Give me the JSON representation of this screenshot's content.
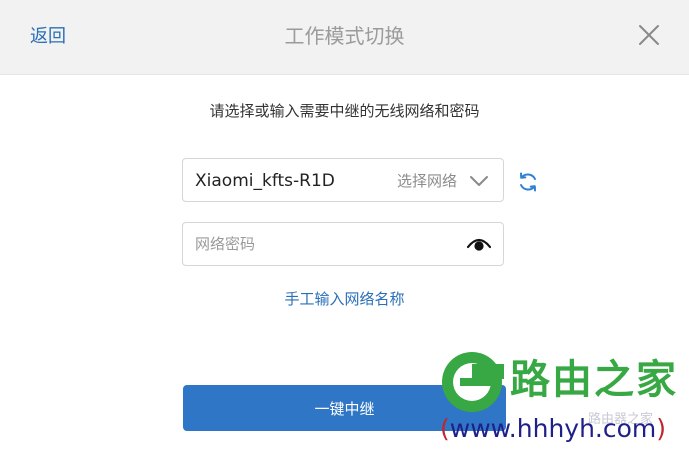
{
  "header": {
    "back_label": "返回",
    "title": "工作模式切换"
  },
  "form": {
    "instruction": "请选择或输入需要中继的无线网络和密码",
    "network": {
      "selected": "Xiaomi_kfts-R1D",
      "select_hint": "选择网络"
    },
    "password": {
      "value": "",
      "placeholder": "网络密码"
    },
    "manual_link": "手工输入网络名称",
    "submit_label": "一键中继"
  },
  "watermark": {
    "brand": "路由之家",
    "url_open": "(",
    "url": "www.hhhyh.com",
    "url_close": ")",
    "small": "路由器之家"
  },
  "colors": {
    "accent": "#2f76c6",
    "link": "#2a6fb8",
    "header_bg": "#f2f2f2",
    "brand_green": "#37a843"
  },
  "icons": {
    "close": "close-icon",
    "chevron": "chevron-down-icon",
    "refresh": "refresh-icon",
    "eye": "eye-icon"
  }
}
